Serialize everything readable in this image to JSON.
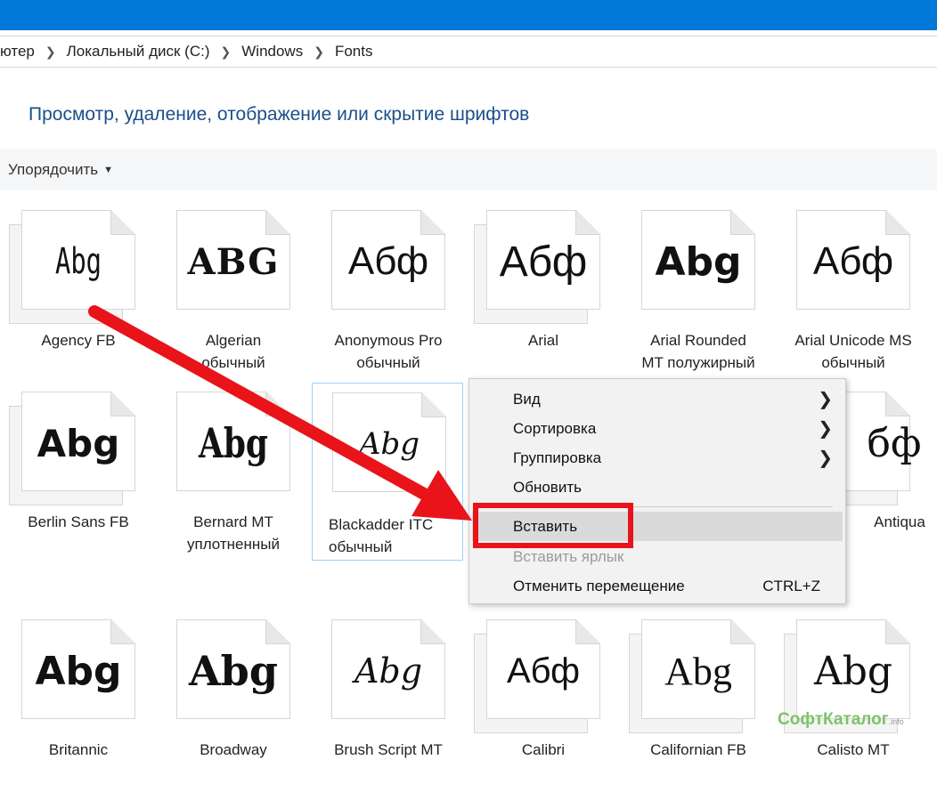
{
  "breadcrumb": [
    "ютер",
    "Локальный диск (C:)",
    "Windows",
    "Fonts"
  ],
  "page_title": "Просмотр, удаление, отображение или скрытие шрифтов",
  "toolbar": {
    "sort_label": "Упорядочить"
  },
  "fonts": [
    {
      "name": "Agency FB",
      "sample": "Abg",
      "stacked": true
    },
    {
      "name": "Algerian",
      "sub": "обычный",
      "sample": "ABG"
    },
    {
      "name": "Anonymous Pro",
      "sub": "обычный",
      "sample": "Абф"
    },
    {
      "name": "Arial",
      "sample": "Абф",
      "stacked": true
    },
    {
      "name": "Arial Rounded",
      "sub": "MT полужирный",
      "sample": "Abg"
    },
    {
      "name": "Arial Unicode MS",
      "sub": "обычный",
      "sample": "Абф"
    },
    {
      "name": "Berlin Sans FB",
      "sample": "Abg",
      "stacked": true
    },
    {
      "name": "Bernard MT",
      "sub": "уплотненный",
      "sample": "Abg"
    },
    {
      "name": "Blackadder ITC",
      "sub": "обычный",
      "sample": "Abg",
      "selected": true
    },
    {
      "name": "Antiqua",
      "sample": "бф",
      "stacked": true
    },
    {
      "name": "Britannic",
      "sample": "Abg"
    },
    {
      "name": "Broadway",
      "sample": "Abg"
    },
    {
      "name": "Brush Script MT",
      "sample": "Abg"
    },
    {
      "name": "Calibri",
      "sample": "Абф",
      "stacked": true
    },
    {
      "name": "Californian FB",
      "sample": "Abg",
      "stacked": true
    },
    {
      "name": "Calisto MT",
      "sample": "Abg",
      "stacked": true
    }
  ],
  "context_menu": {
    "view": "Вид",
    "sort": "Сортировка",
    "group": "Группировка",
    "refresh": "Обновить",
    "paste": "Вставить",
    "paste_shortcut": "Вставить ярлык",
    "undo_move": "Отменить перемещение",
    "undo_move_shortcut": "CTRL+Z"
  },
  "watermark": {
    "main": "СофтКаталог",
    "suffix": ".info"
  },
  "colors": {
    "titlebar": "#0078d7",
    "accent": "#1b4f8a",
    "highlight_box": "#e8141a",
    "arrow": "#e8141a"
  }
}
